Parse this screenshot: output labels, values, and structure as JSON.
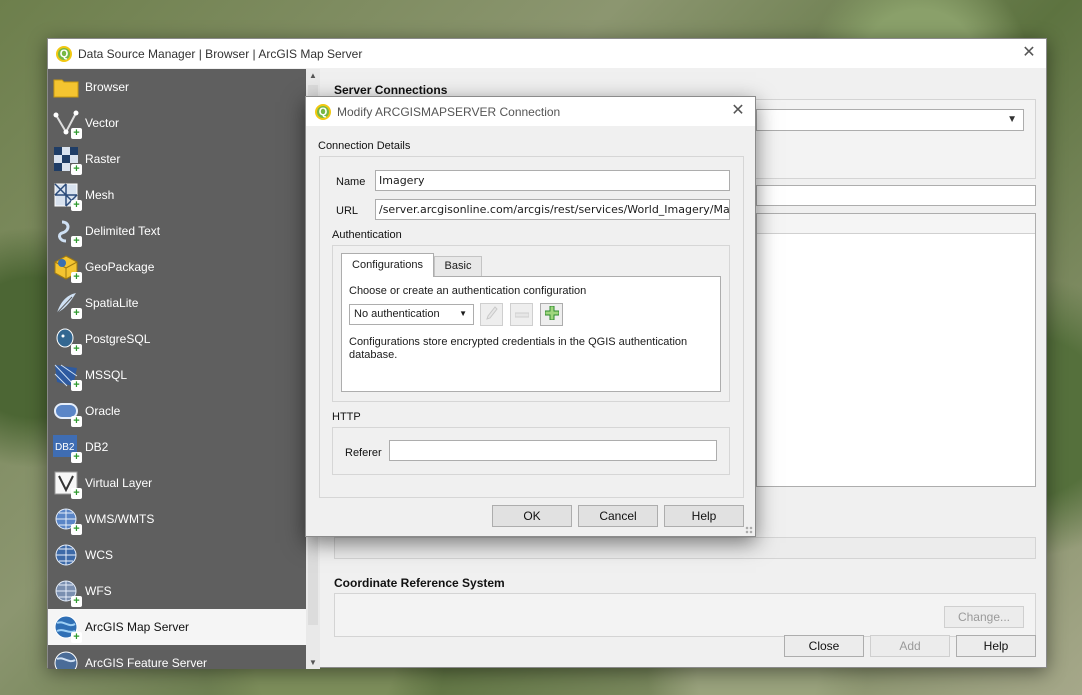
{
  "window": {
    "title": "Data Source Manager | Browser | ArcGIS Map Server",
    "close_glyph": "✕"
  },
  "sidebar": {
    "items": [
      {
        "label": "Browser",
        "icon": "folder-icon"
      },
      {
        "label": "Vector",
        "icon": "vector-icon"
      },
      {
        "label": "Raster",
        "icon": "raster-icon"
      },
      {
        "label": "Mesh",
        "icon": "mesh-icon"
      },
      {
        "label": "Delimited Text",
        "icon": "delimited-text-icon"
      },
      {
        "label": "GeoPackage",
        "icon": "geopackage-icon"
      },
      {
        "label": "SpatiaLite",
        "icon": "spatialite-icon"
      },
      {
        "label": "PostgreSQL",
        "icon": "postgresql-icon"
      },
      {
        "label": "MSSQL",
        "icon": "mssql-icon"
      },
      {
        "label": "Oracle",
        "icon": "oracle-icon"
      },
      {
        "label": "DB2",
        "icon": "db2-icon"
      },
      {
        "label": "Virtual Layer",
        "icon": "virtual-layer-icon"
      },
      {
        "label": "WMS/WMTS",
        "icon": "wms-icon"
      },
      {
        "label": "WCS",
        "icon": "wcs-icon"
      },
      {
        "label": "WFS",
        "icon": "wfs-icon"
      },
      {
        "label": "ArcGIS Map Server",
        "icon": "arcgis-map-server-icon"
      },
      {
        "label": "ArcGIS Feature Server",
        "icon": "arcgis-feature-server-icon"
      }
    ],
    "active_index": 15
  },
  "main": {
    "server_connections_title": "Server Connections",
    "crs_title": "Coordinate Reference System",
    "change_label": "Change...",
    "close_label": "Close",
    "add_label": "Add",
    "help_label": "Help"
  },
  "dialog": {
    "title": "Modify ARCGISMAPSERVER Connection",
    "close_glyph": "✕",
    "connection_details_label": "Connection Details",
    "name_label": "Name",
    "name_value": "Imagery",
    "url_label": "URL",
    "url_value": "/server.arcgisonline.com/arcgis/rest/services/World_Imagery/MapServer",
    "authentication_label": "Authentication",
    "tabs": [
      "Configurations",
      "Basic"
    ],
    "auth_prompt": "Choose or create an authentication configuration",
    "auth_select_value": "No authentication",
    "auth_info": "Configurations store encrypted credentials in the QGIS authentication database.",
    "http_label": "HTTP",
    "referer_label": "Referer",
    "referer_value": "",
    "ok_label": "OK",
    "cancel_label": "Cancel",
    "help_label": "Help"
  },
  "colors": {
    "sidebar_bg": "#5f5f5f",
    "qgis_green": "#77b843",
    "qgis_yellow": "#f2c811"
  }
}
